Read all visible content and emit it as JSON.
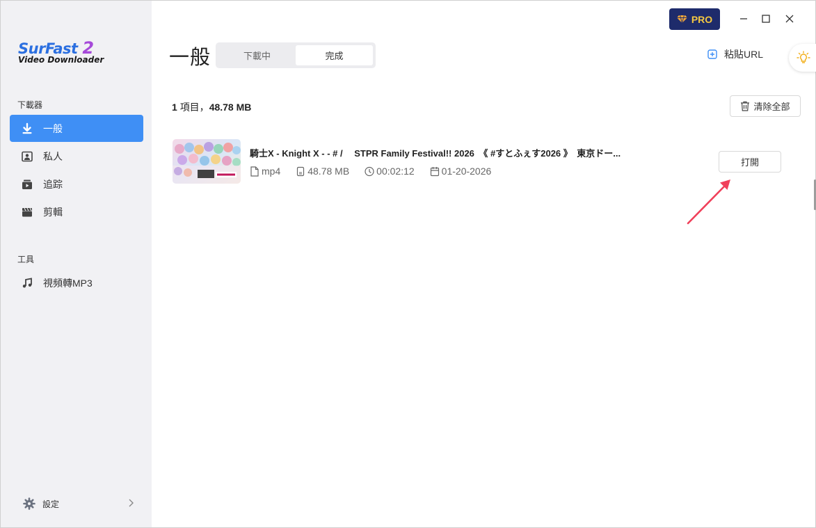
{
  "app": {
    "logo_main": "SurFast",
    "logo_num": "2",
    "logo_sub": "Video Downloader"
  },
  "sidebar": {
    "section_downloader": "下載器",
    "items": [
      {
        "label": "一般",
        "icon": "download-arrow-icon"
      },
      {
        "label": "私人",
        "icon": "private-icon"
      },
      {
        "label": "追踪",
        "icon": "track-icon"
      },
      {
        "label": "剪輯",
        "icon": "clapper-icon"
      }
    ],
    "section_tools": "工具",
    "tools": [
      {
        "label": "視頻轉MP3",
        "icon": "music-note-icon"
      }
    ],
    "settings_label": "設定"
  },
  "titlebar": {
    "pro_label": "PRO"
  },
  "header": {
    "title": "一般",
    "tabs": [
      {
        "label": "下載中",
        "active": false
      },
      {
        "label": "完成",
        "active": true
      }
    ],
    "paste_label": "粘貼URL"
  },
  "list": {
    "count_num": "1",
    "count_text": "項目，",
    "count_size": "48.78 MB",
    "clear_label": "清除全部",
    "items": [
      {
        "title": "騎士X - Knight X - - # /　 STPR Family Festival!! 2026　《 #すとふぇす2026 》　東京ドー...",
        "format": "mp4",
        "size": "48.78 MB",
        "duration": "00:02:12",
        "date": "01-20-2026",
        "open_label": "打開"
      }
    ]
  },
  "colors": {
    "accent": "#3f8ff5",
    "pro_bg": "#1e2b6b",
    "pro_fg": "#f5c842",
    "sidebar_bg": "#f1f1f4",
    "arrow": "#f0405a"
  }
}
